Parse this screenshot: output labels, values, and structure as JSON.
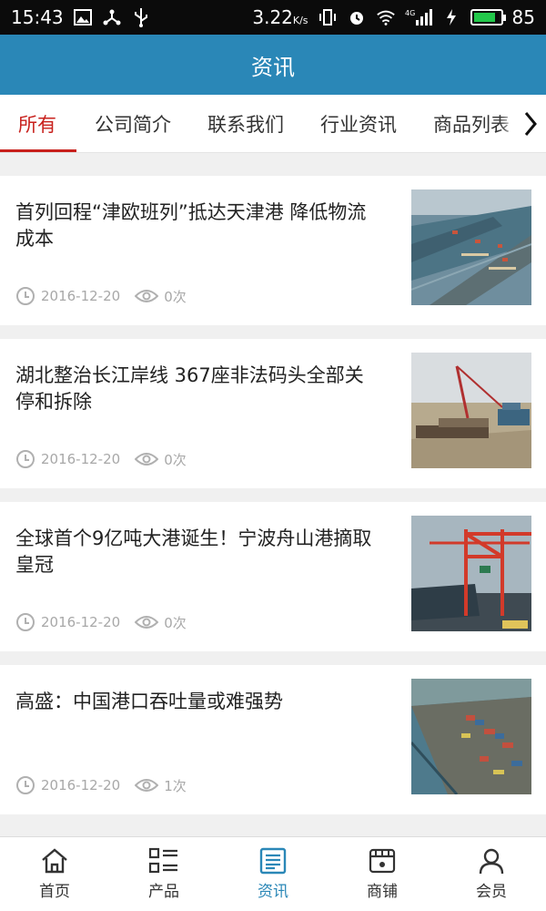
{
  "status_bar": {
    "time": "15:43",
    "speed": "3.22",
    "speed_unit": "K/s",
    "signal_label": "4G",
    "battery": "85",
    "battery_color": "#22c84a"
  },
  "header": {
    "title": "资讯"
  },
  "tabs": [
    {
      "label": "所有",
      "active": true
    },
    {
      "label": "公司简介"
    },
    {
      "label": "联系我们"
    },
    {
      "label": "行业资讯"
    },
    {
      "label": "商品列表"
    }
  ],
  "news": [
    {
      "title": "首列回程“津欧班列”抵达天津港 降低物流成本",
      "date": "2016-12-20",
      "views": "0次"
    },
    {
      "title": "湖北整治长江岸线 367座非法码头全部关停和拆除",
      "date": "2016-12-20",
      "views": "0次"
    },
    {
      "title": "全球首个9亿吨大港诞生！宁波舟山港摘取皇冠",
      "date": "2016-12-20",
      "views": "0次"
    },
    {
      "title": "高盛：中国港口吞吐量或难强势",
      "date": "2016-12-20",
      "views": "1次"
    }
  ],
  "bottom_nav": [
    {
      "label": "首页",
      "icon": "home-icon"
    },
    {
      "label": "产品",
      "icon": "grid-list-icon"
    },
    {
      "label": "资讯",
      "icon": "news-icon",
      "active": true
    },
    {
      "label": "商铺",
      "icon": "shop-icon"
    },
    {
      "label": "会员",
      "icon": "user-icon"
    }
  ],
  "colors": {
    "header": "#2a87b7",
    "active_tab": "#c8201c",
    "active_nav": "#2a87b7"
  }
}
